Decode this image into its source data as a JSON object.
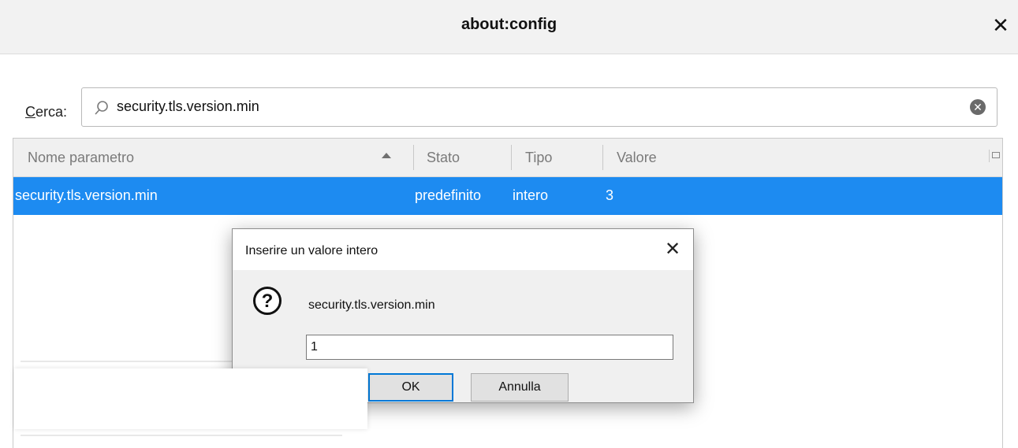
{
  "window": {
    "title": "about:config",
    "close_glyph": "✕"
  },
  "search": {
    "label_prefix": "C",
    "label_rest": "erca:",
    "value": "security.tls.version.min",
    "clear_glyph": "✕"
  },
  "table": {
    "columns": [
      "Nome parametro",
      "Stato",
      "Tipo",
      "Valore"
    ],
    "sort": "ascending",
    "selected_row": {
      "name": "security.tls.version.min",
      "status": "predefinito",
      "type": "intero",
      "value": "3"
    }
  },
  "dialog": {
    "title": "Inserire un valore intero",
    "close_glyph": "✕",
    "icon": "question-icon",
    "icon_glyph": "?",
    "message": "security.tls.version.min",
    "input_value": "1",
    "ok_label": "OK",
    "cancel_label": "Annulla"
  },
  "colors": {
    "selection": "#1d8bf1",
    "default_button_border": "#0078d7"
  }
}
